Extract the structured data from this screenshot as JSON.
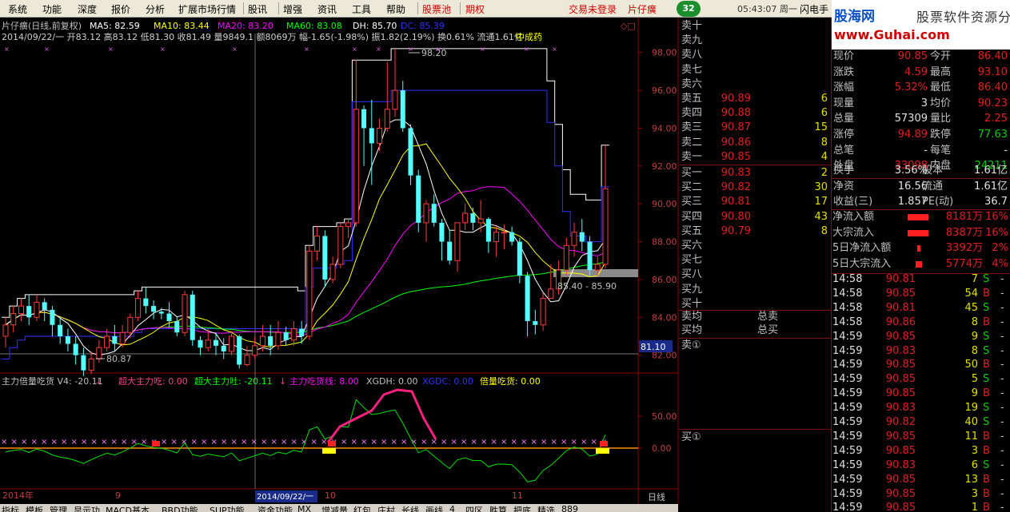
{
  "menubar": {
    "items": [
      "系统",
      "功能",
      "深度",
      "报价",
      "分析",
      "扩展市场行情",
      "股讯",
      "增强",
      "资讯",
      "工具",
      "帮助"
    ],
    "red_items": [
      "股票池",
      "期权"
    ],
    "trade_status": "交易未登录",
    "stock_short": "片仔癀",
    "badge": "32",
    "clock": "05:43:07 周一",
    "flash": "闪电手"
  },
  "logo": {
    "site_cn": "股海网",
    "slogan": "股票软件资源分享",
    "url": "www.Guhai.com"
  },
  "chart_header": {
    "line1_prefix": "片仔癀(日线,前复权)",
    "ma5": "MA5: 82.59",
    "ma10": "MA10: 83.44",
    "ma20": "MA20: 83.20",
    "ma60": "MA60: 83.08",
    "dh": "DH: 85.70",
    "dc": "DC: 85.39",
    "line2": "2014/09/22/一 开83.12 高83.12 低81.30 收81.49 量9849.1 额8069万 幅-1.65(-1.98%) 振1.82(2.19%) 换0.61% 流通1.61亿",
    "sector": "中成药"
  },
  "indicator_header": {
    "name": "主力倍量吃货 V4: -20.11",
    "s1": "超大主力吃: 0.00",
    "s2": "超大主力吐: -20.11",
    "s3": "主力吃货线: 8.00",
    "s4": "XGDH: 0.00",
    "s5": "XGDC: 0.00",
    "s6": "倍量吃货: 0.00"
  },
  "chart_data": {
    "type": "candlestick",
    "price_ticks": [
      "98.00",
      "96.00",
      "94.00",
      "92.00",
      "90.00",
      "88.00",
      "86.00",
      "84.00",
      "82.00"
    ],
    "price_range": [
      81.1,
      99.0
    ],
    "cursor_price": "81.10",
    "high_label": "98.20",
    "low_label": "80.87",
    "band_label": "85.40 - 85.90",
    "indicator_ticks": [
      "50.00",
      "0.00"
    ],
    "x_labels": [
      "2014年",
      "9",
      "2014/09/22/一",
      "10",
      "11"
    ],
    "period": "日线",
    "candles": [
      [
        83.0,
        83.6,
        82.4,
        84.0
      ],
      [
        83.6,
        84.2,
        83.2,
        84.6
      ],
      [
        84.2,
        84.6,
        83.8,
        85.0
      ],
      [
        84.6,
        84.0,
        83.6,
        85.2
      ],
      [
        84.0,
        84.8,
        83.8,
        85.2
      ],
      [
        84.8,
        84.4,
        83.8,
        85.0
      ],
      [
        84.4,
        83.6,
        83.0,
        84.6
      ],
      [
        83.6,
        83.0,
        82.6,
        84.0
      ],
      [
        83.0,
        82.6,
        82.2,
        83.4
      ],
      [
        82.6,
        82.0,
        81.5,
        83.0
      ],
      [
        82.0,
        81.2,
        80.9,
        82.4
      ],
      [
        81.2,
        81.8,
        81.0,
        82.2
      ],
      [
        81.8,
        82.4,
        81.6,
        82.8
      ],
      [
        82.4,
        83.0,
        82.2,
        83.4
      ],
      [
        83.0,
        82.6,
        82.2,
        83.6
      ],
      [
        82.6,
        83.2,
        82.4,
        83.6
      ],
      [
        83.2,
        84.0,
        82.9,
        84.2
      ],
      [
        84.0,
        85.0,
        83.8,
        85.4
      ],
      [
        85.0,
        84.6,
        84.2,
        85.6
      ],
      [
        84.6,
        84.3,
        83.9,
        84.9
      ],
      [
        84.3,
        84.2,
        83.9,
        84.5
      ],
      [
        84.2,
        83.8,
        83.5,
        84.8
      ],
      [
        83.8,
        83.2,
        83.0,
        84.0
      ],
      [
        83.2,
        85.2,
        83.0,
        85.4
      ],
      [
        85.2,
        82.8,
        82.5,
        85.4
      ],
      [
        82.8,
        82.4,
        82.0,
        83.0
      ],
      [
        82.4,
        82.8,
        82.2,
        83.4
      ],
      [
        82.8,
        82.5,
        82.0,
        83.2
      ],
      [
        82.5,
        82.2,
        81.8,
        82.9
      ],
      [
        82.2,
        83.0,
        82.0,
        83.3
      ],
      [
        83.0,
        81.5,
        81.3,
        83.1
      ],
      [
        81.5,
        82.0,
        81.4,
        82.5
      ],
      [
        82.0,
        82.5,
        81.8,
        83.0
      ],
      [
        82.5,
        83.0,
        82.2,
        83.6
      ],
      [
        83.0,
        82.5,
        82.0,
        83.6
      ],
      [
        82.5,
        83.2,
        82.3,
        83.8
      ],
      [
        83.2,
        82.8,
        82.5,
        83.5
      ],
      [
        82.8,
        83.4,
        82.5,
        83.8
      ],
      [
        83.4,
        83.0,
        82.6,
        83.8
      ],
      [
        83.0,
        87.5,
        82.8,
        87.8
      ],
      [
        87.5,
        88.3,
        87.0,
        88.8
      ],
      [
        88.3,
        86.0,
        85.6,
        88.6
      ],
      [
        86.0,
        86.8,
        85.8,
        87.2
      ],
      [
        86.8,
        88.8,
        86.6,
        89.0
      ],
      [
        88.8,
        89.0,
        88.2,
        89.2
      ],
      [
        89.0,
        95.0,
        88.8,
        97.6
      ],
      [
        95.0,
        94.0,
        92.0,
        95.2
      ],
      [
        94.0,
        93.2,
        91.0,
        95.5
      ],
      [
        93.2,
        94.0,
        92.8,
        94.5
      ],
      [
        94.0,
        95.0,
        93.8,
        97.5
      ],
      [
        95.0,
        96.0,
        94.6,
        98.2
      ],
      [
        96.0,
        94.0,
        93.8,
        96.5
      ],
      [
        94.0,
        91.5,
        91.0,
        94.2
      ],
      [
        91.5,
        89.0,
        88.5,
        91.8
      ],
      [
        89.0,
        90.0,
        88.0,
        90.2
      ],
      [
        90.0,
        89.0,
        88.8,
        90.5
      ],
      [
        89.0,
        88.0,
        87.0,
        89.2
      ],
      [
        88.0,
        87.0,
        86.8,
        88.6
      ],
      [
        87.0,
        89.0,
        86.4,
        89.0
      ],
      [
        89.0,
        89.5,
        88.6,
        90.0
      ],
      [
        89.5,
        89.0,
        88.6,
        89.8
      ],
      [
        89.0,
        89.2,
        88.5,
        90.2
      ],
      [
        89.2,
        88.0,
        87.4,
        89.3
      ],
      [
        88.0,
        88.5,
        87.2,
        88.8
      ],
      [
        88.5,
        88.5,
        87.6,
        88.9
      ],
      [
        88.5,
        88.0,
        87.8,
        88.8
      ],
      [
        88.0,
        86.2,
        85.8,
        88.2
      ],
      [
        86.2,
        83.8,
        83.0,
        86.4
      ],
      [
        83.8,
        83.6,
        83.1,
        84.4
      ],
      [
        83.6,
        85.0,
        83.3,
        85.3
      ],
      [
        85.0,
        85.5,
        85.0,
        86.8
      ],
      [
        85.5,
        86.5,
        85.2,
        87.0
      ],
      [
        86.5,
        87.8,
        86.2,
        88.2
      ],
      [
        87.8,
        88.5,
        87.2,
        89.0
      ],
      [
        88.5,
        88.0,
        87.5,
        89.2
      ],
      [
        88.0,
        86.5,
        86.2,
        88.3
      ],
      [
        86.5,
        86.8,
        86.2,
        87.2
      ],
      [
        86.8,
        90.8,
        86.6,
        93.1
      ]
    ]
  },
  "quote": {
    "asks": [
      {
        "label": "卖十",
        "price": "",
        "vol": ""
      },
      {
        "label": "卖九",
        "price": "",
        "vol": ""
      },
      {
        "label": "卖八",
        "price": "",
        "vol": ""
      },
      {
        "label": "卖七",
        "price": "",
        "vol": ""
      },
      {
        "label": "卖六",
        "price": "",
        "vol": ""
      },
      {
        "label": "卖五",
        "price": "90.89",
        "vol": "6"
      },
      {
        "label": "卖四",
        "price": "90.88",
        "vol": "6"
      },
      {
        "label": "卖三",
        "price": "90.87",
        "vol": "15"
      },
      {
        "label": "卖二",
        "price": "90.86",
        "vol": "8"
      },
      {
        "label": "卖一",
        "price": "90.85",
        "vol": "4"
      }
    ],
    "bids": [
      {
        "label": "买一",
        "price": "90.83",
        "vol": "2"
      },
      {
        "label": "买二",
        "price": "90.82",
        "vol": "30"
      },
      {
        "label": "买三",
        "price": "90.81",
        "vol": "17"
      },
      {
        "label": "买四",
        "price": "90.80",
        "vol": "43"
      },
      {
        "label": "买五",
        "price": "90.79",
        "vol": "8"
      },
      {
        "label": "买六",
        "price": "",
        "vol": ""
      },
      {
        "label": "买七",
        "price": "",
        "vol": ""
      },
      {
        "label": "买八",
        "price": "",
        "vol": ""
      },
      {
        "label": "买九",
        "price": "",
        "vol": ""
      },
      {
        "label": "买十",
        "price": "",
        "vol": ""
      }
    ],
    "avg_sell": "卖均",
    "avg_buy": "买均",
    "total_sell": "总卖",
    "total_buy": "总买",
    "sell_queue": "卖①",
    "buy_queue": "买①"
  },
  "stats": [
    {
      "l1": "现价",
      "v1": "90.85",
      "l2": "今开",
      "v2": "86.40",
      "c1": "red",
      "c2": "red"
    },
    {
      "l1": "涨跌",
      "v1": "4.59",
      "l2": "最高",
      "v2": "93.10",
      "c1": "red",
      "c2": "red"
    },
    {
      "l1": "涨幅",
      "v1": "5.32%",
      "l2": "最低",
      "v2": "86.40",
      "c1": "red",
      "c2": "red"
    },
    {
      "l1": "现量",
      "v1": "3",
      "l2": "均价",
      "v2": "90.23",
      "c1": "wht",
      "c2": "red"
    },
    {
      "l1": "总量",
      "v1": "57309",
      "l2": "量比",
      "v2": "2.25",
      "c1": "wht",
      "c2": "red"
    },
    {
      "l1": "涨停",
      "v1": "94.89",
      "l2": "跌停",
      "v2": "77.63",
      "c1": "red",
      "c2": "grn"
    },
    {
      "l1": "总笔",
      "v1": "-",
      "l2": "每笔",
      "v2": "-",
      "c1": "wht",
      "c2": "wht"
    },
    {
      "l1": "外盘",
      "v1": "33098",
      "l2": "内盘",
      "v2": "24211",
      "c1": "red",
      "c2": "grn"
    }
  ],
  "stats2": [
    {
      "l1": "换手",
      "v1": "3.56%",
      "l2": "股本",
      "v2": "1.61亿"
    },
    {
      "l1": "净资",
      "v1": "16.56",
      "l2": "流通",
      "v2": "1.61亿"
    },
    {
      "l1": "收益(三)",
      "v1": "1.857",
      "l2": "PE(动)",
      "v2": "36.7"
    }
  ],
  "flows": [
    {
      "label": "净流入额",
      "value": "8181万",
      "pct": "16%",
      "bar": 0.85
    },
    {
      "label": "大宗流入",
      "value": "8387万",
      "pct": "16%",
      "bar": 0.88
    },
    {
      "label": "5日净流入额",
      "value": "3392万",
      "pct": "2%",
      "bar": 0.15
    },
    {
      "label": "5日大宗流入",
      "value": "5774万",
      "pct": "4%",
      "bar": 0.25
    }
  ],
  "ticks": [
    {
      "t": "14:58",
      "p": "90.81",
      "v": "7",
      "s": "S"
    },
    {
      "t": "14:58",
      "p": "90.85",
      "v": "54",
      "s": "B"
    },
    {
      "t": "14:58",
      "p": "90.81",
      "v": "45",
      "s": "S"
    },
    {
      "t": "14:58",
      "p": "90.86",
      "v": "8",
      "s": "B"
    },
    {
      "t": "14:59",
      "p": "90.85",
      "v": "9",
      "s": "S"
    },
    {
      "t": "14:59",
      "p": "90.83",
      "v": "8",
      "s": "S"
    },
    {
      "t": "14:59",
      "p": "90.85",
      "v": "50",
      "s": "B"
    },
    {
      "t": "14:59",
      "p": "90.85",
      "v": "5",
      "s": "S"
    },
    {
      "t": "14:59",
      "p": "90.85",
      "v": "9",
      "s": "B"
    },
    {
      "t": "14:59",
      "p": "90.83",
      "v": "19",
      "s": "S"
    },
    {
      "t": "14:59",
      "p": "90.82",
      "v": "40",
      "s": "S"
    },
    {
      "t": "14:59",
      "p": "90.85",
      "v": "11",
      "s": "B"
    },
    {
      "t": "14:59",
      "p": "90.85",
      "v": "3",
      "s": "B"
    },
    {
      "t": "14:59",
      "p": "90.83",
      "v": "6",
      "s": "S"
    },
    {
      "t": "14:59",
      "p": "90.85",
      "v": "13",
      "s": "B"
    },
    {
      "t": "14:59",
      "p": "90.85",
      "v": "3",
      "s": "B"
    },
    {
      "t": "14:59",
      "p": "90.85",
      "v": "1",
      "s": "B"
    }
  ],
  "tabs": [
    "指标",
    "模板",
    "管理",
    "显示功",
    "MACD基本",
    "BBD功能",
    "SUP功能",
    "资金功能",
    "MX",
    "增减量",
    "红包",
    "庄村",
    "长线",
    "画线",
    "4",
    "四区",
    "胜算",
    "把底",
    "精选",
    "889"
  ],
  "colors": {
    "up": "#ff3c3c",
    "down": "#54ffff",
    "ma5": "#ffffff",
    "ma10": "#ffff00",
    "ma20": "#ff00ff",
    "ma60": "#00ff00",
    "dh": "#ffffff",
    "dc": "#3030ff"
  }
}
